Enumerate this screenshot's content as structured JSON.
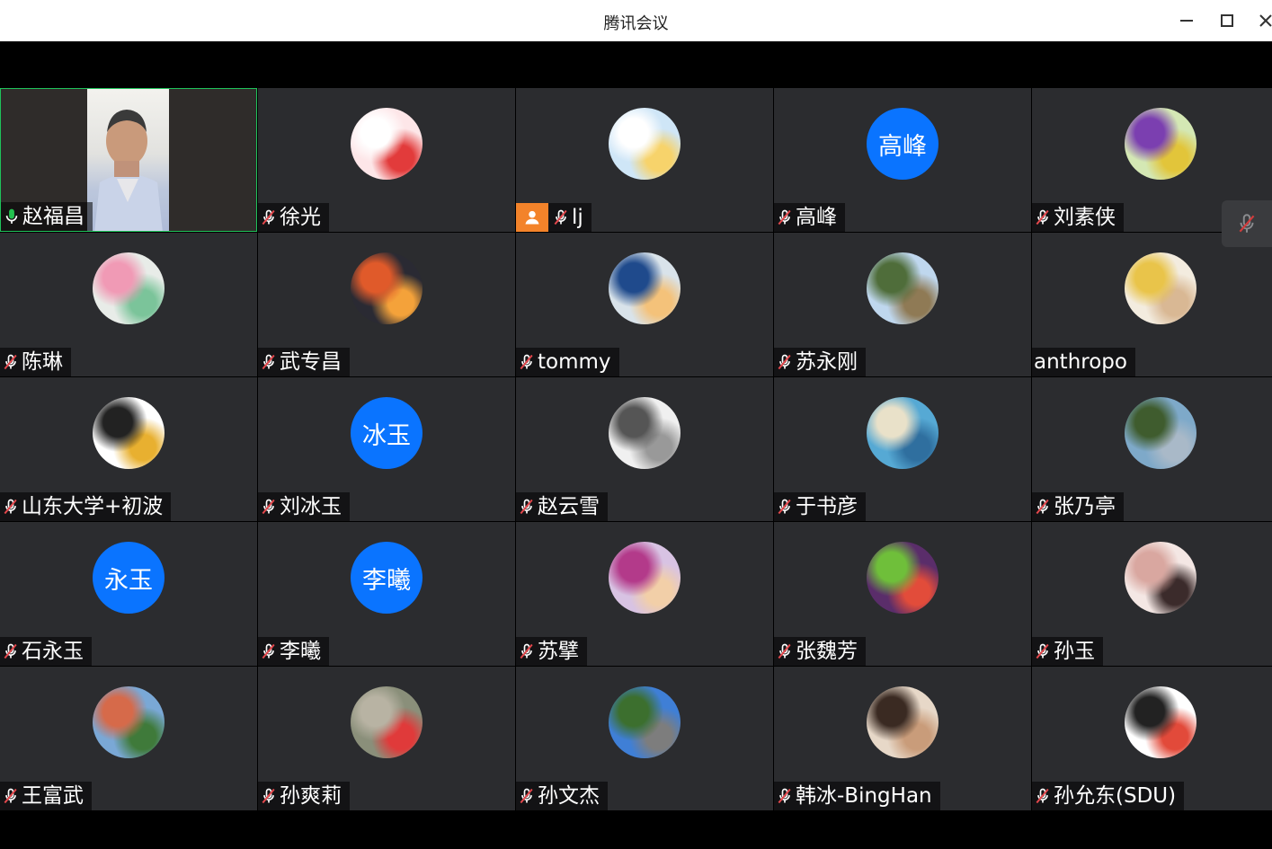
{
  "window": {
    "title": "腾讯会议"
  },
  "controls": {
    "minimize": "minimize-icon",
    "maximize": "maximize-icon",
    "close": "close-icon"
  },
  "side_button": {
    "icon": "mic-muted-icon"
  },
  "participants": [
    {
      "name": "赵福昌",
      "mic": "on",
      "video": true
    },
    {
      "name": "徐光",
      "mic": "muted",
      "avatar": "photo",
      "colors": [
        "#fde6e8",
        "#ffffff",
        "#e23b3b"
      ]
    },
    {
      "name": "lj",
      "mic": "muted",
      "avatar": "photo",
      "badge": "user-icon",
      "colors": [
        "#cfe6f7",
        "#ffffff",
        "#f7d36b"
      ]
    },
    {
      "name": "高峰",
      "mic": "muted",
      "avatar_text": "高峰"
    },
    {
      "name": "刘素侠",
      "mic": "muted",
      "avatar": "photo",
      "colors": [
        "#d4e8b4",
        "#7b3fb0",
        "#e2c53a"
      ]
    },
    {
      "name": "陈琳",
      "mic": "muted",
      "avatar": "photo",
      "colors": [
        "#e8ece8",
        "#f09ab5",
        "#7bc49a"
      ]
    },
    {
      "name": "武专昌",
      "mic": "muted",
      "avatar": "photo",
      "colors": [
        "#2a2a33",
        "#e05a2a",
        "#f4a23a"
      ]
    },
    {
      "name": "tommy",
      "mic": "muted",
      "avatar": "photo",
      "colors": [
        "#d9e3ea",
        "#1f4a8c",
        "#f4c27a"
      ]
    },
    {
      "name": "苏永刚",
      "mic": "muted",
      "avatar": "photo",
      "colors": [
        "#bfd7ee",
        "#4f6d3a",
        "#8f7a55"
      ]
    },
    {
      "name": "anthropo",
      "mic": "none",
      "avatar": "photo",
      "colors": [
        "#f3ecdf",
        "#e9c44a",
        "#d9b894"
      ]
    },
    {
      "name": "山东大学+初波",
      "mic": "muted",
      "avatar": "photo",
      "colors": [
        "#ffffff",
        "#222222",
        "#e8b030"
      ]
    },
    {
      "name": "刘冰玉",
      "mic": "muted",
      "avatar_text": "冰玉"
    },
    {
      "name": "赵云雪",
      "mic": "muted",
      "avatar": "photo",
      "colors": [
        "#f0f0f0",
        "#555555",
        "#999999"
      ]
    },
    {
      "name": "于书彦",
      "mic": "muted",
      "avatar": "photo",
      "colors": [
        "#56a9d4",
        "#e9e1c9",
        "#2f6f9f"
      ]
    },
    {
      "name": "张乃亭",
      "mic": "muted",
      "avatar": "photo",
      "colors": [
        "#7ea9c9",
        "#3f5c2e",
        "#a9b9c8"
      ]
    },
    {
      "name": "石永玉",
      "mic": "muted",
      "avatar_text": "永玉"
    },
    {
      "name": "李曦",
      "mic": "muted",
      "avatar_text": "李曦"
    },
    {
      "name": "苏擘",
      "mic": "muted",
      "avatar": "photo",
      "colors": [
        "#d8c3e3",
        "#b33a8a",
        "#f2cfa8"
      ]
    },
    {
      "name": "张魏芳",
      "mic": "muted",
      "avatar": "photo",
      "colors": [
        "#5a2d6a",
        "#6fbf3a",
        "#e24c3a"
      ]
    },
    {
      "name": "孙玉",
      "mic": "muted",
      "avatar": "photo",
      "colors": [
        "#f4e7e4",
        "#d9a7a0",
        "#3b2b2b"
      ]
    },
    {
      "name": "王富武",
      "mic": "muted",
      "avatar": "photo",
      "colors": [
        "#7aa8d6",
        "#d66a4a",
        "#3f7a3a"
      ]
    },
    {
      "name": "孙爽莉",
      "mic": "muted",
      "avatar": "photo",
      "colors": [
        "#8a8f7a",
        "#b8b3a3",
        "#e03a3a"
      ]
    },
    {
      "name": "孙文杰",
      "mic": "muted",
      "avatar": "photo",
      "colors": [
        "#3f7fd6",
        "#3c6f2e",
        "#7d7d7d"
      ]
    },
    {
      "name": "韩冰-BingHan",
      "mic": "muted",
      "avatar": "photo",
      "colors": [
        "#e7d8c8",
        "#3a2a22",
        "#c99c7a"
      ]
    },
    {
      "name": "孙允东(SDU)",
      "mic": "muted",
      "avatar": "photo",
      "colors": [
        "#ffffff",
        "#222222",
        "#e24a3a"
      ]
    }
  ]
}
